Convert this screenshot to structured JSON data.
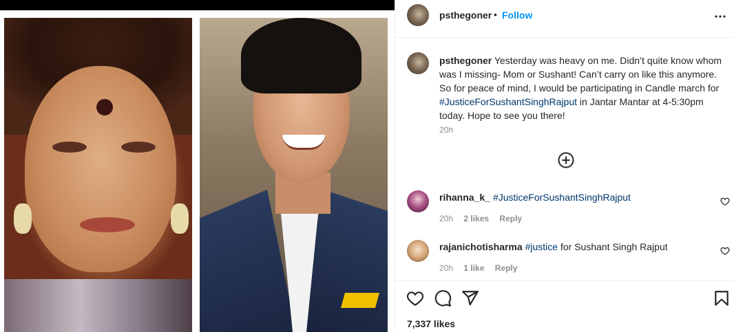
{
  "post": {
    "username": "psthegoner",
    "follow_label": "Follow",
    "separator": "•",
    "more_icon": "more-options-icon"
  },
  "caption": {
    "username": "psthegoner",
    "text_before": " Yesterday was heavy on me. Didn’t quite know whom was I missing- Mom or Sushant! Can’t carry on like this anymore. So for peace of mind, I would be participating in Candle march for ",
    "hashtag": "#JusticeForSushantSinghRajput",
    "text_after": " in Jantar Mantar at 4-5:30pm today. Hope to see you there!",
    "time": "20h",
    "load_more_icon": "plus-circle-icon"
  },
  "comments": [
    {
      "username": "rihanna_k_",
      "text_before": "",
      "hashtag": "#JusticeForSushantSinghRajput",
      "text_after": "",
      "time": "20h",
      "likes": "2 likes",
      "reply_label": "Reply"
    },
    {
      "username": "rajanichotisharma",
      "text_before": "",
      "hashtag": "#justice",
      "text_after": " for Sushant Singh Rajput",
      "time": "20h",
      "likes": "1 like",
      "reply_label": "Reply"
    }
  ],
  "actions": {
    "like_icon": "heart-icon",
    "comment_icon": "comment-icon",
    "share_icon": "share-icon",
    "save_icon": "bookmark-icon",
    "likes_count": "7,337 likes"
  },
  "colors": {
    "link": "#0095f6",
    "hashtag": "#00376b",
    "muted": "#8e8e8e",
    "text": "#262626"
  }
}
